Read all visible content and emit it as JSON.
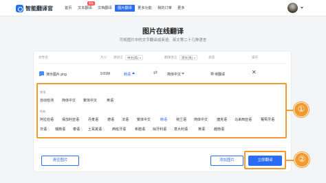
{
  "app": {
    "logo_text": "智能翻译官"
  },
  "nav": {
    "items": [
      "首页",
      "文本翻译",
      "文档翻译",
      "图片翻译",
      "更多功能",
      "我的订单",
      "更多"
    ],
    "badge": "限免",
    "active_index": 3
  },
  "hero": {
    "title": "图片在线翻译",
    "subtitle": "可将图片中的文字翻译成英语、英文等二十几种语言"
  },
  "table": {
    "headers": {
      "file": "文件名",
      "size": "大小",
      "source": "源语言",
      "target": "翻译语言",
      "status": "状态",
      "action": "操作"
    },
    "source_select": "中文(简)",
    "target_select": "英文(英)",
    "row": {
      "filename": "演示图片.png",
      "size": "9.81M",
      "source_lang": "韩语",
      "target_lang": "简体中文",
      "status": "待翻译",
      "remove": "✕"
    }
  },
  "languages": {
    "common_label": "常用",
    "common": [
      "自动检测",
      "简体中文",
      "繁体中文",
      "英语"
    ],
    "all_label": "所有",
    "all_row1": [
      "阿拉伯语",
      "保加利亚语",
      "丹麦语",
      "德语",
      "法语",
      "繁体中文",
      "韩语",
      "荷兰语",
      "简体中文",
      "捷克语",
      "马来西亚语",
      "葡萄牙语"
    ],
    "all_row2": [
      "日语",
      "瑞典语",
      "泰语",
      "土耳其语",
      "西班牙语",
      "希腊语",
      "匈牙利语",
      "意大利语",
      "英语",
      "越南语"
    ],
    "selected": "韩语"
  },
  "annotations": {
    "callout_1": "①",
    "callout_2": "②"
  },
  "buttons": {
    "clear": "清空图片",
    "add": "添加图片",
    "translate": "立即翻译"
  },
  "colors": {
    "accent": "#2b6cf6",
    "highlight": "#f29a2e"
  }
}
